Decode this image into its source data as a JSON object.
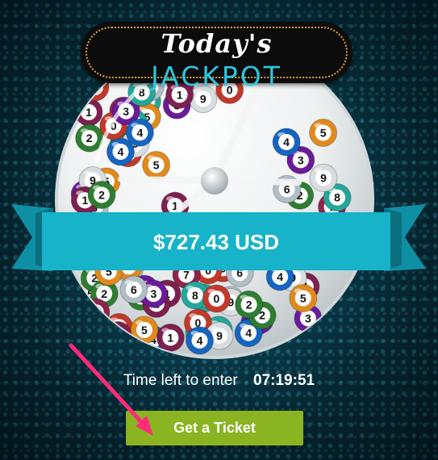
{
  "header": {
    "title_top": "Today's",
    "title_main": "JACKPOT"
  },
  "jackpot": {
    "amount": "$727.43 USD"
  },
  "entry": {
    "time_label": "Time left to enter",
    "countdown": "07:19:51"
  },
  "cta": {
    "label": "Get a Ticket"
  },
  "colors": {
    "accent": "#2cc6dc",
    "ribbon": "#16b3c9",
    "button": "#8bb423",
    "arrow": "#ff2a78"
  },
  "balls": [
    "0",
    "1",
    "2",
    "3",
    "4",
    "5",
    "6",
    "7",
    "8",
    "9"
  ]
}
